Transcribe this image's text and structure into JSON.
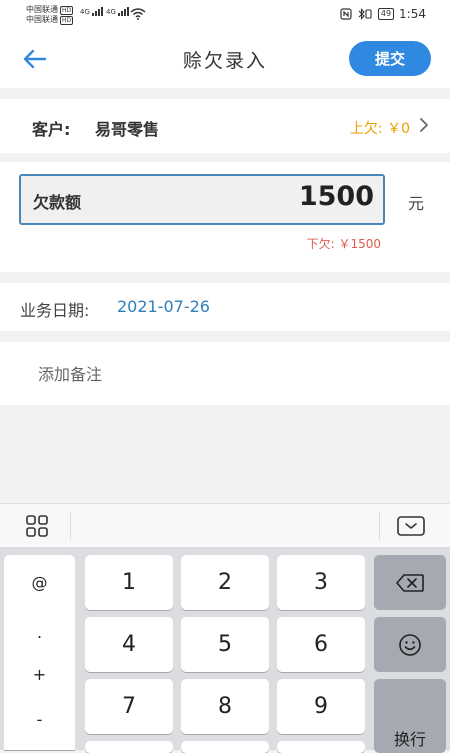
{
  "status_bar": {
    "carrier1": "中国联通",
    "carrier2": "中国联通",
    "hd": "HD",
    "net1": "4G",
    "net2": "4G",
    "battery": "49",
    "time": "1:54"
  },
  "header": {
    "title": "赊欠录入",
    "submit_label": "提交"
  },
  "customer": {
    "label": "客户:",
    "name": "易哥零售",
    "previous_debt": "上欠: ￥0"
  },
  "amount": {
    "label": "欠款额",
    "value": "1500",
    "unit": "元",
    "next_debt": "下欠: ￥1500"
  },
  "date": {
    "label": "业务日期:",
    "value": "2021-07-26"
  },
  "remark": {
    "placeholder": "添加备注"
  },
  "keyboard": {
    "symbols": [
      "@",
      ".",
      "+",
      "-"
    ],
    "keys": [
      "1",
      "2",
      "3",
      "4",
      "5",
      "6",
      "7",
      "8",
      "9"
    ],
    "enter_label": "换行"
  },
  "colors": {
    "accent": "#2f89e0",
    "previous_debt": "#e6a100",
    "next_debt": "#e05a4e",
    "date": "#2f7fb8"
  },
  "icons": [
    "back-arrow-icon",
    "chevron-right-icon",
    "grid-icon",
    "keyboard-hide-icon",
    "backspace-icon",
    "emoji-icon"
  ]
}
